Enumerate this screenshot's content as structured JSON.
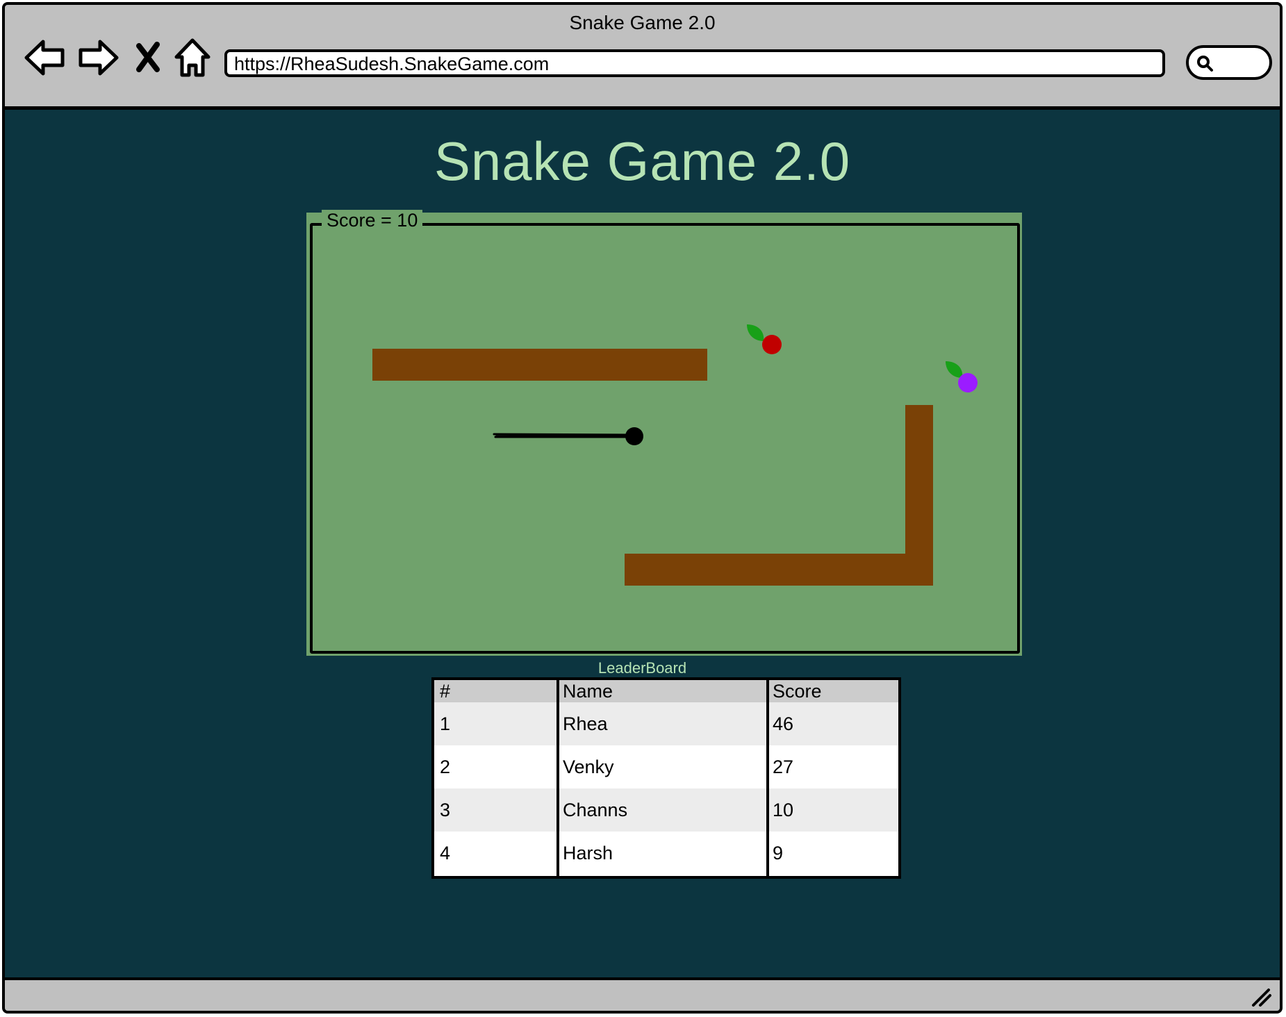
{
  "browser": {
    "window_title": "Snake Game 2.0",
    "url": "https://RheaSudesh.SnakeGame.com",
    "buttons": {
      "back_icon": "arrow-left-icon",
      "forward_icon": "arrow-right-icon",
      "stop_icon": "close-x-icon",
      "home_icon": "home-icon",
      "search_icon": "magnifier-icon"
    }
  },
  "page": {
    "title": "Snake Game 2.0",
    "score_text": "Score = 10"
  },
  "game": {
    "colors": {
      "board": "#70a26c",
      "wall": "#7a4106",
      "snake": "#000000",
      "fruit_red": "#c00000",
      "fruit_purple": "#9b1cff",
      "leaf": "#18a018"
    },
    "fruits": [
      "red-fruit-icon",
      "purple-fruit-icon"
    ]
  },
  "leaderboard": {
    "caption": "LeaderBoard",
    "columns": [
      "#",
      "Name",
      "Score"
    ],
    "rows": [
      {
        "rank": "1",
        "name": "Rhea",
        "score": "46"
      },
      {
        "rank": "2",
        "name": "Venky",
        "score": "27"
      },
      {
        "rank": "3",
        "name": "Channs",
        "score": "10"
      },
      {
        "rank": "4",
        "name": "Harsh",
        "score": "9"
      }
    ]
  },
  "theme": {
    "page_background": "#0c3540",
    "accent_text": "#b6e3b4",
    "chrome": "#c0c0c0"
  }
}
